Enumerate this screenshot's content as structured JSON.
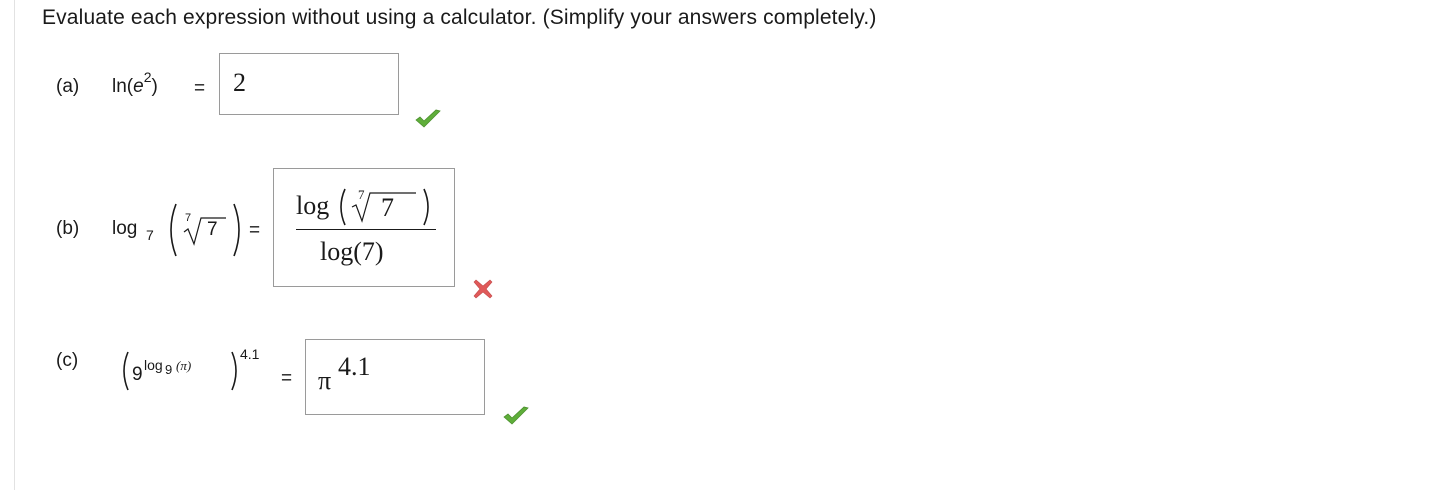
{
  "instructions": "Evaluate each expression without using a calculator. (Simplify your answers completely.)",
  "questions": [
    {
      "label": "(a)",
      "fn": "ln",
      "base": "e",
      "exponent": "2",
      "equals": "=",
      "answer": "2",
      "status": "correct"
    },
    {
      "label": "(b)",
      "fn": "log",
      "fn_sub": "7",
      "root_index": "7",
      "radicand": "7",
      "equals": "=",
      "answer_num_fn": "log",
      "answer_num_root_index": "7",
      "answer_num_radicand": "7",
      "answer_den": "log(7)",
      "status": "incorrect"
    },
    {
      "label": "(c)",
      "outer_base": "9",
      "inner_fn": "log",
      "inner_sub": "9",
      "inner_arg": "(π)",
      "outer_exp": "4.1",
      "equals": "=",
      "answer_base": "π",
      "answer_exp": "4.1",
      "status": "correct"
    }
  ],
  "icons": {
    "correct": "checkmark-icon",
    "incorrect": "x-mark-icon"
  },
  "colors": {
    "correct": "#5fae3a",
    "incorrect": "#e05a5a",
    "box_border": "#9a9a9a"
  }
}
